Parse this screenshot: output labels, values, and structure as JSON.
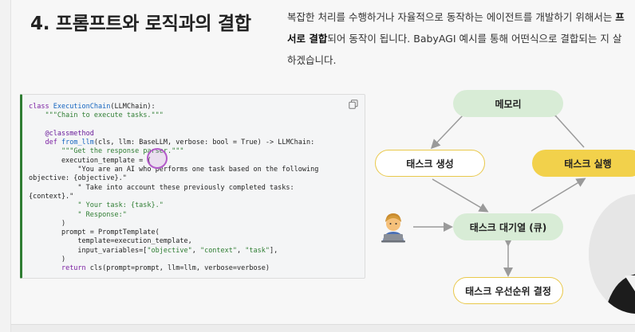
{
  "section": {
    "title": "4. 프롬프트와 로직과의 결합",
    "intro_lines": [
      {
        "plain": "복잡한 처리를 수행하거나 자율적으로 동작하는 에이전트를 개발하기 위해서는 ",
        "bold": "프"
      },
      {
        "bold": "서로 결합",
        "plain": "되어 동작이 됩니다. BabyAGI 예시를 통해 어떤식으로 결합되는 지 살"
      },
      {
        "plain": "하겠습니다."
      }
    ]
  },
  "code_block": {
    "copy_icon": "copy-icon",
    "lines": [
      "class ExecutionChain(LLMChain):",
      "    \"\"\"Chain to execute tasks.\"\"\"",
      "",
      "    @classmethod",
      "    def from_llm(cls, llm: BaseLLM, verbose: bool = True) -> LLMChain:",
      "        \"\"\"Get the response parser.\"\"\"",
      "        execution_template = (",
      "            \"You are an AI who performs one task based on the following",
      "objective: {objective}.\"",
      "            \" Take into account these previously completed tasks:",
      "{context}.\"",
      "            \" Your task: {task}.\"",
      "            \" Response:\"",
      "        )",
      "        prompt = PromptTemplate(",
      "            template=execution_template,",
      "            input_variables=[\"objective\", \"context\", \"task\"],",
      "        )",
      "        return cls(prompt=prompt, llm=llm, verbose=verbose)"
    ]
  },
  "diagram": {
    "memory": "메모리",
    "task_create": "태스크 생성",
    "task_execute": "태스크 실행",
    "task_queue": "태스크 대기열 (큐)",
    "task_priority": "태스크 우선순위 결정",
    "user_icon": "person-at-laptop-icon"
  },
  "colors": {
    "green_node": "#d8ecd6",
    "yellow_node": "#f2d14b",
    "yellow_border": "#e9c84a",
    "arrow": "#9a9a9a",
    "code_accent": "#2e7d32"
  }
}
